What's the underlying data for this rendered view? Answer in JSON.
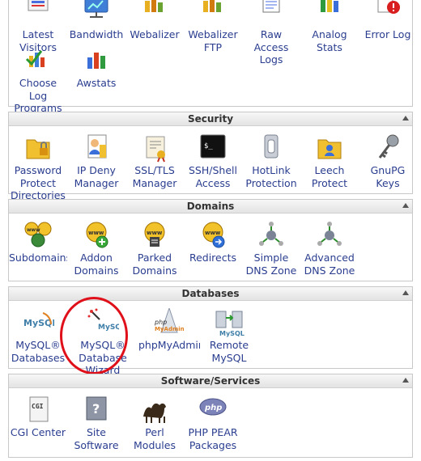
{
  "stats": {
    "items": [
      {
        "id": "latest-visitors",
        "label": "Latest Visitors",
        "icon": "latest-visitors-icon"
      },
      {
        "id": "bandwidth",
        "label": "Bandwidth",
        "icon": "bandwidth-icon"
      },
      {
        "id": "webalizer",
        "label": "Webalizer",
        "icon": "webalizer-icon"
      },
      {
        "id": "webalizer-ftp",
        "label": "Webalizer FTP",
        "icon": "webalizer-ftp-icon"
      },
      {
        "id": "raw-access-logs",
        "label": "Raw Access Logs",
        "icon": "raw-access-logs-icon"
      },
      {
        "id": "analog-stats",
        "label": "Analog Stats",
        "icon": "analog-stats-icon"
      },
      {
        "id": "error-log",
        "label": "Error Log",
        "icon": "error-log-icon"
      },
      {
        "id": "choose-log-programs",
        "label": "Choose Log Programs",
        "icon": "choose-log-programs-icon"
      },
      {
        "id": "awstats",
        "label": "Awstats",
        "icon": "awstats-icon"
      }
    ]
  },
  "security": {
    "title": "Security",
    "items": [
      {
        "label": "Password Protect Directories",
        "icon": "folder-lock-icon"
      },
      {
        "label": "IP Deny Manager",
        "icon": "ip-deny-icon"
      },
      {
        "label": "SSL/TLS Manager",
        "icon": "ssl-certificate-icon"
      },
      {
        "label": "SSH/Shell Access",
        "icon": "terminal-icon"
      },
      {
        "label": "HotLink Protection",
        "icon": "chain-link-icon"
      },
      {
        "label": "Leech Protect",
        "icon": "leech-protect-icon"
      },
      {
        "label": "GnuPG Keys",
        "icon": "keys-icon"
      }
    ]
  },
  "domains": {
    "title": "Domains",
    "items": [
      {
        "label": "Subdomains",
        "icon": "subdomains-icon"
      },
      {
        "label": "Addon Domains",
        "icon": "addon-domains-icon"
      },
      {
        "label": "Parked Domains",
        "icon": "parked-domains-icon"
      },
      {
        "label": "Redirects",
        "icon": "redirects-icon"
      },
      {
        "label": "Simple DNS Zone",
        "icon": "simple-dns-icon"
      },
      {
        "label": "Advanced DNS Zone",
        "icon": "advanced-dns-icon"
      }
    ]
  },
  "databases": {
    "title": "Databases",
    "items": [
      {
        "label": "MySQL® Databases",
        "icon": "mysql-icon"
      },
      {
        "label": "MySQL® Database Wizard",
        "icon": "mysql-wizard-icon"
      },
      {
        "label": "phpMyAdmin",
        "icon": "phpmyadmin-icon"
      },
      {
        "label": "Remote MySQL",
        "icon": "remote-mysql-icon"
      }
    ],
    "icon_text": {
      "mysql": "MySQL",
      "php": "php",
      "myadmin": "MyAdmin"
    }
  },
  "software": {
    "title": "Software/Services",
    "items": [
      {
        "label": "CGI Center",
        "icon": "cgi-icon"
      },
      {
        "label": "Site Software",
        "icon": "site-software-icon"
      },
      {
        "label": "Perl Modules",
        "icon": "perl-camel-icon"
      },
      {
        "label": "PHP PEAR Packages",
        "icon": "php-pear-icon"
      }
    ],
    "icon_text": {
      "cgi": "CGI",
      "php": "php"
    }
  },
  "www_text": "www",
  "colors": {
    "link": "#2a3d8f",
    "annotation": "#e0101a",
    "header_bg": "#e8e8e8"
  }
}
